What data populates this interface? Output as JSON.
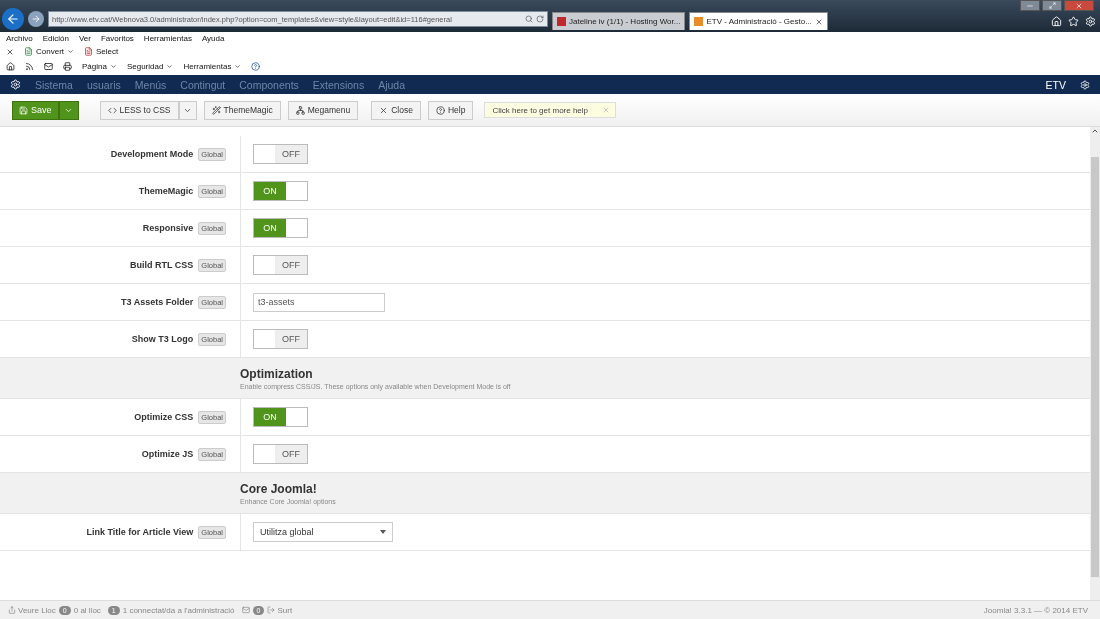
{
  "browser": {
    "address": "http://www.etv.cat/Webnova3.0/administrator/index.php?option=com_templates&view=style&layout=edit&id=116#general",
    "tabs": [
      {
        "title": "Jateline iv (1/1) - Hosting Wor...",
        "selected": false
      },
      {
        "title": "ETV - Administració - Gesto...",
        "selected": true
      }
    ],
    "menu": [
      "Archivo",
      "Edición",
      "Ver",
      "Favoritos",
      "Herramientas",
      "Ayuda"
    ],
    "command_bar": [
      {
        "label": "Convert",
        "kind": "convert"
      },
      {
        "label": "Select",
        "kind": "select"
      }
    ],
    "toolbar": [
      "Página",
      "Seguridad",
      "Herramientas"
    ]
  },
  "navbar": {
    "items": [
      "Sistema",
      "usuaris",
      "Menús",
      "Contingut",
      "Components",
      "Extensions",
      "Ajuda"
    ],
    "user": "ETV"
  },
  "toolbar": {
    "buttons": [
      {
        "label": "Save",
        "kind": "save"
      },
      {
        "label": "LESS to CSS",
        "kind": "less"
      },
      {
        "label": "ThemeMagic",
        "kind": "magic"
      },
      {
        "label": "Megamenu",
        "kind": "megamenu"
      },
      {
        "label": "Close",
        "kind": "close"
      },
      {
        "label": "Help",
        "kind": "help"
      }
    ],
    "hint": "Click here to get more help"
  },
  "settings": [
    {
      "kind": "toggle",
      "label": "Development Mode",
      "badge": "Global",
      "on": false,
      "value": "OFF"
    },
    {
      "kind": "toggle",
      "label": "ThemeMagic",
      "badge": "Global",
      "on": true,
      "value": "ON"
    },
    {
      "kind": "toggle",
      "label": "Responsive",
      "badge": "Global",
      "on": true,
      "value": "ON"
    },
    {
      "kind": "toggle",
      "label": "Build RTL CSS",
      "badge": "Global",
      "on": false,
      "value": "OFF"
    },
    {
      "kind": "text",
      "label": "T3 Assets Folder",
      "badge": "Global",
      "value": "t3-assets"
    },
    {
      "kind": "toggle",
      "label": "Show T3 Logo",
      "badge": "Global",
      "on": false,
      "value": "OFF"
    },
    {
      "kind": "section",
      "label": "Optimization",
      "description": "Enable compress CSS/JS. These options only available when Development Mode is off"
    },
    {
      "kind": "toggle",
      "label": "Optimize CSS",
      "badge": "Global",
      "on": true,
      "value": "ON"
    },
    {
      "kind": "toggle",
      "label": "Optimize JS",
      "badge": "Global",
      "on": false,
      "value": "OFF"
    },
    {
      "kind": "section",
      "label": "Core Joomla!",
      "description": "Enhance Core Joomla! options"
    },
    {
      "kind": "select",
      "label": "Link Title for Article View",
      "badge": "Global",
      "value": "Utilitza global"
    }
  ],
  "status_bar": {
    "view_site": "Veure Lloc",
    "site_count": "0",
    "site_text": "0 al lloc",
    "admin_count": "1",
    "admin_text": "1 connectat/da a l'administració",
    "messages_count": "0",
    "logout": "Surt",
    "footer": "Joomla! 3.3.1 — © 2014 ETV"
  }
}
